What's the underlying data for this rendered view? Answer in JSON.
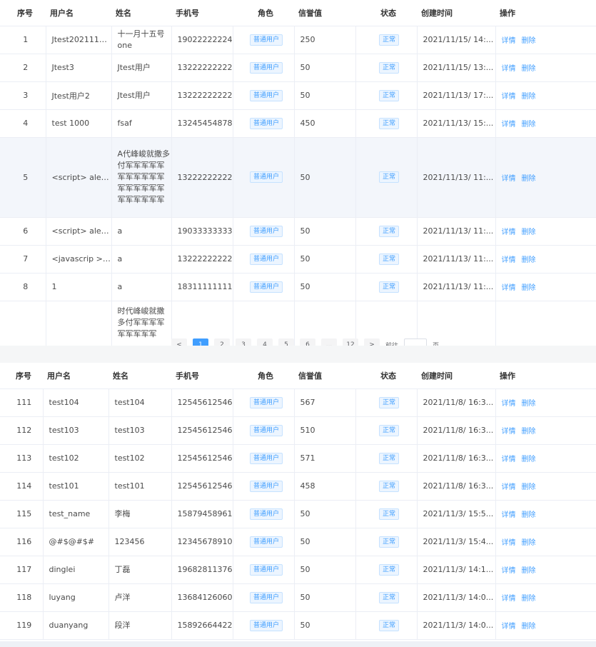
{
  "columns": {
    "index": "序号",
    "username": "用户名",
    "name": "姓名",
    "phone": "手机号",
    "role": "角色",
    "credit": "信誉值",
    "status": "状态",
    "created": "创建时间",
    "actions": "操作"
  },
  "actions": {
    "detail": "详情",
    "delete": "删除"
  },
  "top_rows": [
    {
      "index": "1",
      "username": "Jtest2021111...",
      "name": "十一月十五号 one",
      "phone": "19022222224",
      "role": "普通用户",
      "credit": "250",
      "status": "正常",
      "created": "2021/11/15/ 14:..."
    },
    {
      "index": "2",
      "username": "Jtest3",
      "name": "Jtest用户",
      "phone": "13222222222",
      "role": "普通用户",
      "credit": "50",
      "status": "正常",
      "created": "2021/11/15/ 13:..."
    },
    {
      "index": "3",
      "username": "Jtest用户2",
      "name": "Jtest用户",
      "phone": "13222222222",
      "role": "普通用户",
      "credit": "50",
      "status": "正常",
      "created": "2021/11/13/ 17:..."
    },
    {
      "index": "4",
      "username": "test 1000",
      "name": "fsaf",
      "phone": "13245454878",
      "role": "普通用户",
      "credit": "450",
      "status": "正常",
      "created": "2021/11/13/ 15:..."
    },
    {
      "index": "5",
      "username": "<script> alert...",
      "name": "A代峰峻就撒多付军军军军军军军军军军军军军军军军军军军军军军军",
      "phone": "13222222222",
      "role": "普通用户",
      "credit": "50",
      "status": "正常",
      "created": "2021/11/13/ 11:..."
    },
    {
      "index": "6",
      "username": "<script> alert...",
      "name": "a",
      "phone": "19033333333",
      "role": "普通用户",
      "credit": "50",
      "status": "正常",
      "created": "2021/11/13/ 11:..."
    },
    {
      "index": "7",
      "username": "<javascrip >a...",
      "name": "a",
      "phone": "13222222222",
      "role": "普通用户",
      "credit": "50",
      "status": "正常",
      "created": "2021/11/13/ 11:..."
    },
    {
      "index": "8",
      "username": "1",
      "name": "a",
      "phone": "18311111111",
      "role": "普通用户",
      "credit": "50",
      "status": "正常",
      "created": "2021/11/13/ 11:..."
    },
    {
      "index": "",
      "username": "",
      "name": "时代峰峻就撒多付军军军军军军军军军",
      "phone": "",
      "role": "",
      "credit": "",
      "status": "",
      "created": ""
    }
  ],
  "pagination": {
    "prev": "<",
    "pages": [
      "1",
      "2",
      "3",
      "4",
      "5",
      "6",
      "...",
      "12"
    ],
    "next": ">",
    "goto_label": "前往",
    "page_suffix": "页"
  },
  "bottom_rows": [
    {
      "index": "111",
      "username": "test104",
      "name": "test104",
      "phone": "12545612546",
      "role": "普通用户",
      "credit": "567",
      "status": "正常",
      "created": "2021/11/8/ 16:3..."
    },
    {
      "index": "112",
      "username": "test103",
      "name": "test103",
      "phone": "12545612546",
      "role": "普通用户",
      "credit": "510",
      "status": "正常",
      "created": "2021/11/8/ 16:3..."
    },
    {
      "index": "113",
      "username": "test102",
      "name": "test102",
      "phone": "12545612546",
      "role": "普通用户",
      "credit": "571",
      "status": "正常",
      "created": "2021/11/8/ 16:3..."
    },
    {
      "index": "114",
      "username": "test101",
      "name": "test101",
      "phone": "12545612546",
      "role": "普通用户",
      "credit": "458",
      "status": "正常",
      "created": "2021/11/8/ 16:3..."
    },
    {
      "index": "115",
      "username": "test_name",
      "name": "李梅",
      "phone": "15879458961",
      "role": "普通用户",
      "credit": "50",
      "status": "正常",
      "created": "2021/11/3/ 15:5..."
    },
    {
      "index": "116",
      "username": "@#$@#$#",
      "name": "123456",
      "phone": "12345678910",
      "role": "普通用户",
      "credit": "50",
      "status": "正常",
      "created": "2021/11/3/ 15:4..."
    },
    {
      "index": "117",
      "username": "dinglei",
      "name": "丁磊",
      "phone": "19682811376",
      "role": "普通用户",
      "credit": "50",
      "status": "正常",
      "created": "2021/11/3/ 14:1..."
    },
    {
      "index": "118",
      "username": "luyang",
      "name": "卢洋",
      "phone": "13684126060",
      "role": "普通用户",
      "credit": "50",
      "status": "正常",
      "created": "2021/11/3/ 14:0..."
    },
    {
      "index": "119",
      "username": "duanyang",
      "name": "段洋",
      "phone": "15892664422",
      "role": "普通用户",
      "credit": "50",
      "status": "正常",
      "created": "2021/11/3/ 14:0..."
    }
  ],
  "colors": {
    "accent": "#409eff",
    "tag_bg": "#ecf5ff",
    "tag_border": "#c6e2ff",
    "row_highlight": "#f3f6fb",
    "border": "#ebeef5"
  }
}
